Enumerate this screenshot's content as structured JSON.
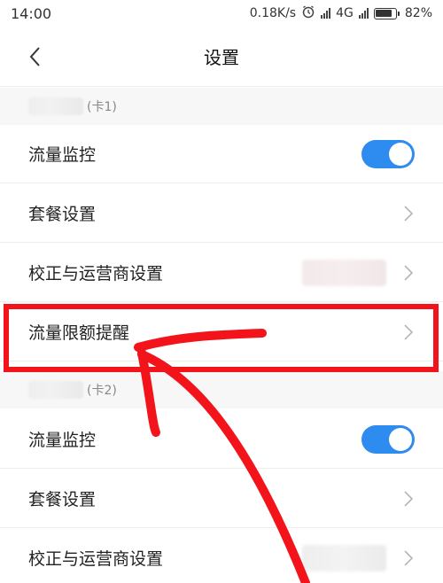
{
  "status_bar": {
    "time": "14:00",
    "speed": "0.18K/s",
    "network": "4G",
    "battery": "82%",
    "battery_level": 0.82
  },
  "header": {
    "title": "设置",
    "back_icon": "chevron-left-icon"
  },
  "sections": [
    {
      "label": "(卡1)",
      "rows": [
        {
          "label": "流量监控",
          "control": "toggle",
          "toggle_on": true
        },
        {
          "label": "套餐设置",
          "control": "chevron"
        },
        {
          "label": "校正与运营商设置",
          "control": "chevron"
        },
        {
          "label": "流量限额提醒",
          "control": "chevron",
          "highlighted": true
        }
      ]
    },
    {
      "label": "(卡2)",
      "rows": [
        {
          "label": "流量监控",
          "control": "toggle",
          "toggle_on": true
        },
        {
          "label": "套餐设置",
          "control": "chevron"
        },
        {
          "label": "校正与运营商设置",
          "control": "chevron"
        }
      ]
    }
  ],
  "colors": {
    "toggle_on": "#2e8bf0",
    "annotation": "#f2141a"
  }
}
